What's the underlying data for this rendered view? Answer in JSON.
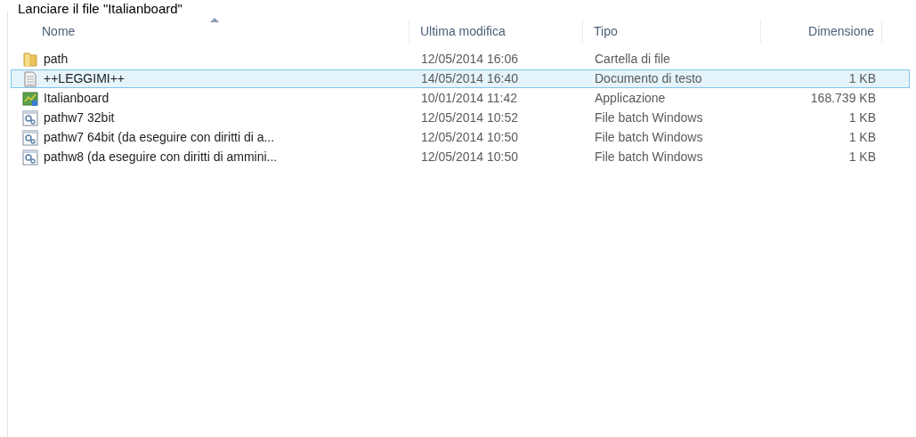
{
  "caption": "Lanciare il file \"Italianboard\"",
  "table": {
    "columns": [
      {
        "label": "Nome",
        "sorted": true
      },
      {
        "label": "Ultima modifica",
        "sorted": false
      },
      {
        "label": "Tipo",
        "sorted": false
      },
      {
        "label": "Dimensione",
        "sorted": false
      }
    ],
    "rows": [
      {
        "kind": "folder",
        "name": "path",
        "modified": "12/05/2014 16:06",
        "type": "Cartella di file",
        "size": "",
        "selected": false
      },
      {
        "kind": "text",
        "name": "++LEGGIMI++",
        "modified": "14/05/2014 16:40",
        "type": "Documento di testo",
        "size": "1 KB",
        "selected": true
      },
      {
        "kind": "app",
        "name": "Italianboard",
        "modified": "10/01/2014 11:42",
        "type": "Applicazione",
        "size": "168.739 KB",
        "selected": false
      },
      {
        "kind": "batch",
        "name": "pathw7 32bit",
        "modified": "12/05/2014 10:52",
        "type": "File batch Windows",
        "size": "1 KB",
        "selected": false
      },
      {
        "kind": "batch",
        "name": "pathw7 64bit (da eseguire con diritti di a...",
        "modified": "12/05/2014 10:50",
        "type": "File batch Windows",
        "size": "1 KB",
        "selected": false
      },
      {
        "kind": "batch",
        "name": "pathw8 (da eseguire con diritti di ammini...",
        "modified": "12/05/2014 10:50",
        "type": "File batch Windows",
        "size": "1 KB",
        "selected": false
      }
    ]
  }
}
